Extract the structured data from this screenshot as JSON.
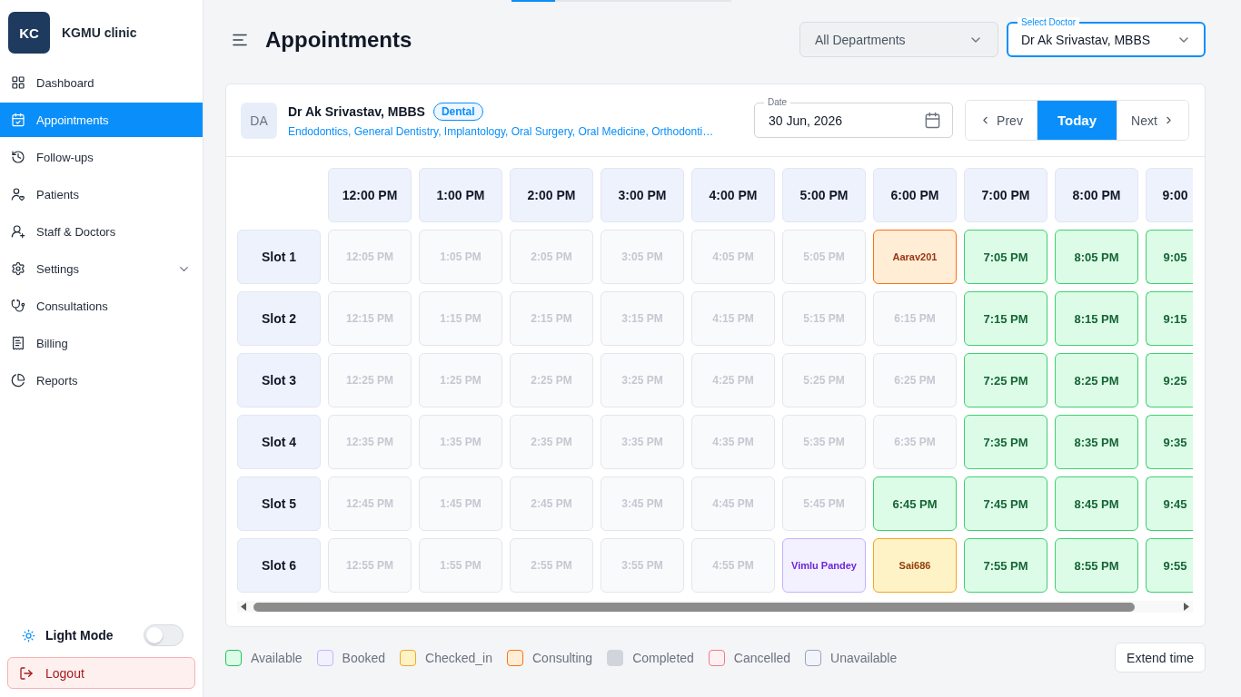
{
  "sidebar": {
    "brand": {
      "initials": "KC",
      "name": "KGMU clinic"
    },
    "items": [
      {
        "label": "Dashboard",
        "selected": false,
        "expandable": false
      },
      {
        "label": "Appointments",
        "selected": true,
        "expandable": false
      },
      {
        "label": "Follow-ups",
        "selected": false,
        "expandable": false
      },
      {
        "label": "Patients",
        "selected": false,
        "expandable": false
      },
      {
        "label": "Staff & Doctors",
        "selected": false,
        "expandable": false
      },
      {
        "label": "Settings",
        "selected": false,
        "expandable": true
      },
      {
        "label": "Consultations",
        "selected": false,
        "expandable": false
      },
      {
        "label": "Billing",
        "selected": false,
        "expandable": false
      },
      {
        "label": "Reports",
        "selected": false,
        "expandable": false
      }
    ],
    "theme_toggle": {
      "label": "Light Mode",
      "on": false
    },
    "logout": "Logout"
  },
  "top_progress": {
    "level": 0.2
  },
  "header": {
    "title": "Appointments",
    "selects": [
      {
        "value": "All Departments",
        "focused": false
      },
      {
        "label": "Select Doctor",
        "value": "Dr Ak Srivastav, MBBS",
        "focused": true
      }
    ]
  },
  "doctor": {
    "initials": "DA",
    "name": "Dr Ak Srivastav, MBBS",
    "department": "Dental",
    "specialties": "Endodontics, General Dentistry, Implantology, Oral Surgery, Oral Medicine, Orthodonti…"
  },
  "date_field": {
    "label": "Date",
    "value": "30 Jun, 2026"
  },
  "nav_buttons": [
    {
      "label": "Prev",
      "kind": "prev",
      "selected": false
    },
    {
      "label": "Today",
      "kind": "today",
      "selected": true
    },
    {
      "label": "Next",
      "kind": "next",
      "selected": false
    }
  ],
  "schedule": {
    "columns": [
      "12:00 PM",
      "1:00 PM",
      "2:00 PM",
      "3:00 PM",
      "4:00 PM",
      "5:00 PM",
      "6:00 PM",
      "7:00 PM",
      "8:00 PM",
      "9:00"
    ],
    "rows": [
      {
        "label": "Slot 1",
        "cells": [
          {
            "text": "12:05 PM",
            "kind": "unavailable"
          },
          {
            "text": "1:05 PM",
            "kind": "unavailable"
          },
          {
            "text": "2:05 PM",
            "kind": "unavailable"
          },
          {
            "text": "3:05 PM",
            "kind": "unavailable"
          },
          {
            "text": "4:05 PM",
            "kind": "unavailable"
          },
          {
            "text": "5:05 PM",
            "kind": "unavailable"
          },
          {
            "text": "Aarav201",
            "kind": "consulting"
          },
          {
            "text": "7:05 PM",
            "kind": "available"
          },
          {
            "text": "8:05 PM",
            "kind": "available"
          },
          {
            "text": "9:05",
            "kind": "available"
          }
        ]
      },
      {
        "label": "Slot 2",
        "cells": [
          {
            "text": "12:15 PM",
            "kind": "unavailable"
          },
          {
            "text": "1:15 PM",
            "kind": "unavailable"
          },
          {
            "text": "2:15 PM",
            "kind": "unavailable"
          },
          {
            "text": "3:15 PM",
            "kind": "unavailable"
          },
          {
            "text": "4:15 PM",
            "kind": "unavailable"
          },
          {
            "text": "5:15 PM",
            "kind": "unavailable"
          },
          {
            "text": "6:15 PM",
            "kind": "unavailable"
          },
          {
            "text": "7:15 PM",
            "kind": "available"
          },
          {
            "text": "8:15 PM",
            "kind": "available"
          },
          {
            "text": "9:15",
            "kind": "available"
          }
        ]
      },
      {
        "label": "Slot 3",
        "cells": [
          {
            "text": "12:25 PM",
            "kind": "unavailable"
          },
          {
            "text": "1:25 PM",
            "kind": "unavailable"
          },
          {
            "text": "2:25 PM",
            "kind": "unavailable"
          },
          {
            "text": "3:25 PM",
            "kind": "unavailable"
          },
          {
            "text": "4:25 PM",
            "kind": "unavailable"
          },
          {
            "text": "5:25 PM",
            "kind": "unavailable"
          },
          {
            "text": "6:25 PM",
            "kind": "unavailable"
          },
          {
            "text": "7:25 PM",
            "kind": "available"
          },
          {
            "text": "8:25 PM",
            "kind": "available"
          },
          {
            "text": "9:25",
            "kind": "available"
          }
        ]
      },
      {
        "label": "Slot 4",
        "cells": [
          {
            "text": "12:35 PM",
            "kind": "unavailable"
          },
          {
            "text": "1:35 PM",
            "kind": "unavailable"
          },
          {
            "text": "2:35 PM",
            "kind": "unavailable"
          },
          {
            "text": "3:35 PM",
            "kind": "unavailable"
          },
          {
            "text": "4:35 PM",
            "kind": "unavailable"
          },
          {
            "text": "5:35 PM",
            "kind": "unavailable"
          },
          {
            "text": "6:35 PM",
            "kind": "unavailable"
          },
          {
            "text": "7:35 PM",
            "kind": "available"
          },
          {
            "text": "8:35 PM",
            "kind": "available"
          },
          {
            "text": "9:35",
            "kind": "available"
          }
        ]
      },
      {
        "label": "Slot 5",
        "cells": [
          {
            "text": "12:45 PM",
            "kind": "unavailable"
          },
          {
            "text": "1:45 PM",
            "kind": "unavailable"
          },
          {
            "text": "2:45 PM",
            "kind": "unavailable"
          },
          {
            "text": "3:45 PM",
            "kind": "unavailable"
          },
          {
            "text": "4:45 PM",
            "kind": "unavailable"
          },
          {
            "text": "5:45 PM",
            "kind": "unavailable"
          },
          {
            "text": "6:45 PM",
            "kind": "available"
          },
          {
            "text": "7:45 PM",
            "kind": "available"
          },
          {
            "text": "8:45 PM",
            "kind": "available"
          },
          {
            "text": "9:45",
            "kind": "available"
          }
        ]
      },
      {
        "label": "Slot 6",
        "cells": [
          {
            "text": "12:55 PM",
            "kind": "unavailable"
          },
          {
            "text": "1:55 PM",
            "kind": "unavailable"
          },
          {
            "text": "2:55 PM",
            "kind": "unavailable"
          },
          {
            "text": "3:55 PM",
            "kind": "unavailable"
          },
          {
            "text": "4:55 PM",
            "kind": "unavailable"
          },
          {
            "text": "Vimlu Pandey",
            "kind": "booked"
          },
          {
            "text": "Sai686",
            "kind": "checked_in"
          },
          {
            "text": "7:55 PM",
            "kind": "available"
          },
          {
            "text": "8:55 PM",
            "kind": "available"
          },
          {
            "text": "9:55",
            "kind": "available"
          }
        ]
      }
    ]
  },
  "legend": [
    {
      "label": "Available",
      "kind": "available"
    },
    {
      "label": "Booked",
      "kind": "booked"
    },
    {
      "label": "Checked_in",
      "kind": "checked_in"
    },
    {
      "label": "Consulting",
      "kind": "consulting"
    },
    {
      "label": "Completed",
      "kind": "completed"
    },
    {
      "label": "Cancelled",
      "kind": "cancelled"
    },
    {
      "label": "Unavailable",
      "kind": "unavailable"
    }
  ],
  "extend_button": "Extend time"
}
